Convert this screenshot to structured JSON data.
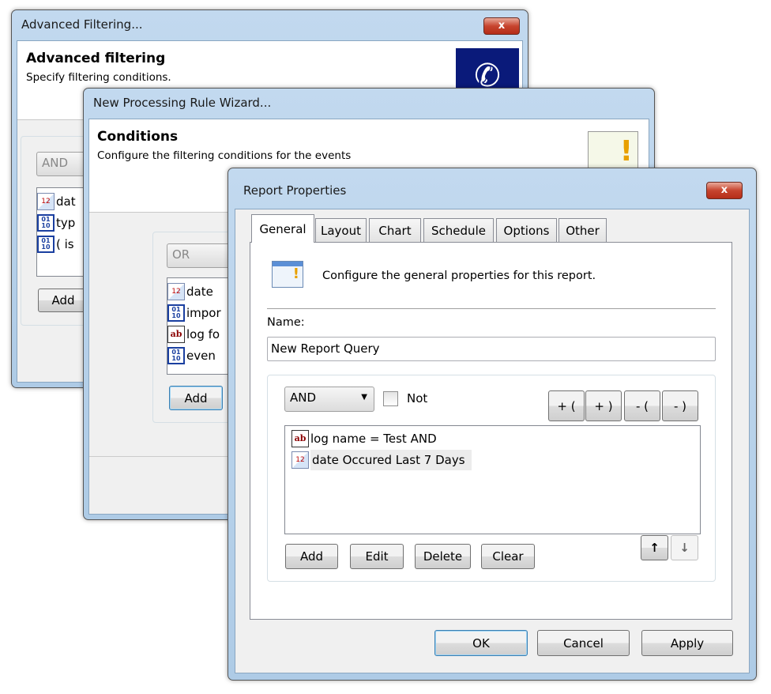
{
  "window1": {
    "title": "Advanced Filtering...",
    "header_title": "Advanced filtering",
    "header_subtitle": "Specify filtering conditions.",
    "combo_value": "AND",
    "items": [
      "dat",
      "typ",
      "( is"
    ],
    "add_label": "Add",
    "close": "x"
  },
  "window2": {
    "title": "New Processing Rule Wizard...",
    "header_title": "Conditions",
    "header_subtitle": "Configure the filtering conditions for the events",
    "combo_value": "OR",
    "items": [
      "date",
      "impor",
      "log fo",
      "even"
    ],
    "add_label": "Add"
  },
  "dialog": {
    "title": "Report Properties",
    "close": "x",
    "tabs": [
      {
        "label": "General",
        "selected": true
      },
      {
        "label": "Layout"
      },
      {
        "label": "Chart"
      },
      {
        "label": "Schedule"
      },
      {
        "label": "Options"
      },
      {
        "label": "Other"
      }
    ],
    "description": "Configure the general properties for this report.",
    "name_label": "Name:",
    "name_value": "New Report Query",
    "operator": "AND",
    "not_label": "Not",
    "not_checked": false,
    "paren_buttons": [
      "+ (",
      "+ )",
      "- (",
      "- )"
    ],
    "conditions": [
      {
        "icon": "text-icon",
        "text": "log name = Test AND"
      },
      {
        "icon": "date-icon",
        "text": "date Occured Last 7 Days",
        "selected": true
      }
    ],
    "list_buttons": [
      "Add",
      "Edit",
      "Delete",
      "Clear"
    ],
    "move_up": "↑",
    "move_down": "↓",
    "ok": "OK",
    "cancel": "Cancel",
    "apply": "Apply"
  }
}
